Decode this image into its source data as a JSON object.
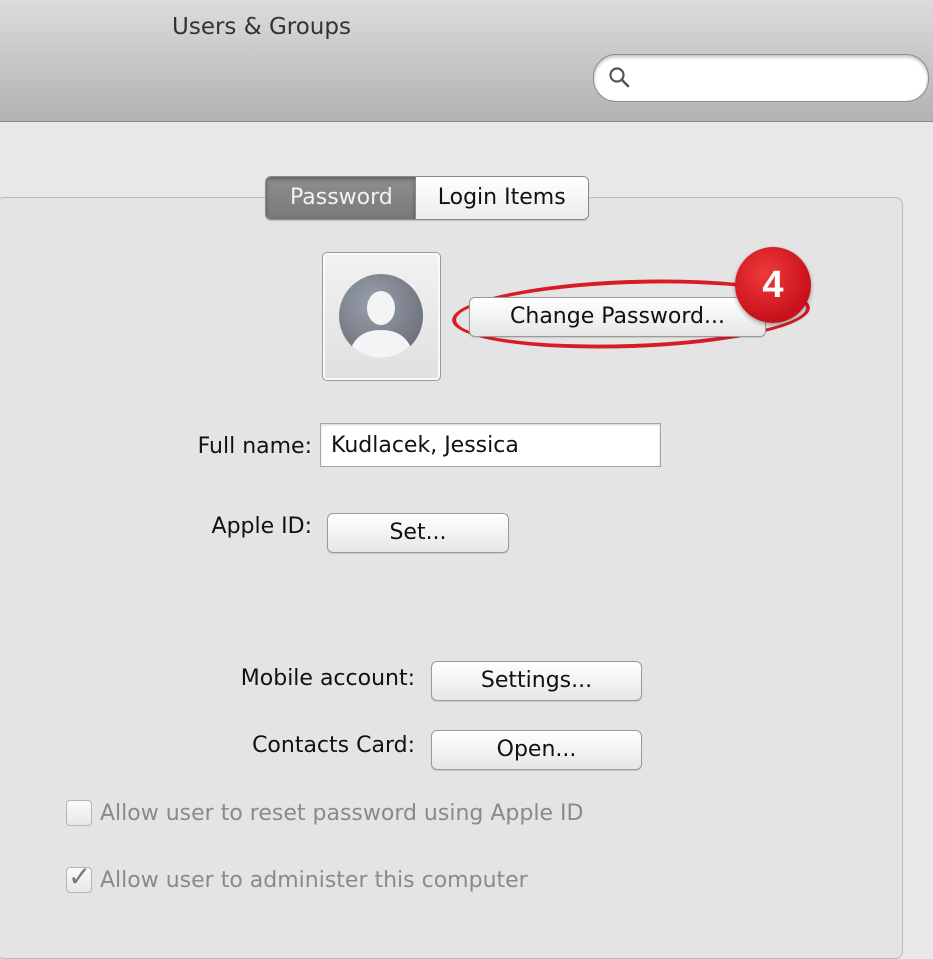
{
  "window": {
    "title": "Users & Groups"
  },
  "search": {
    "placeholder": "",
    "icon": "search-icon"
  },
  "tabs": [
    {
      "label": "Password",
      "active": true
    },
    {
      "label": "Login Items",
      "active": false
    }
  ],
  "user": {
    "avatar_icon": "person-silhouette-icon",
    "change_password_label": "Change Password...",
    "full_name_label": "Full name:",
    "full_name_value": "Kudlacek, Jessica",
    "apple_id_label": "Apple ID:",
    "apple_id_button": "Set..."
  },
  "account": {
    "mobile_label": "Mobile account:",
    "mobile_button": "Settings...",
    "contacts_label": "Contacts Card:",
    "contacts_button": "Open..."
  },
  "options": [
    {
      "label": "Allow user to reset password using Apple ID",
      "checked": false
    },
    {
      "label": "Allow user to administer this computer",
      "checked": true
    }
  ],
  "annotation": {
    "step_number": "4",
    "color": "#d81b26"
  }
}
